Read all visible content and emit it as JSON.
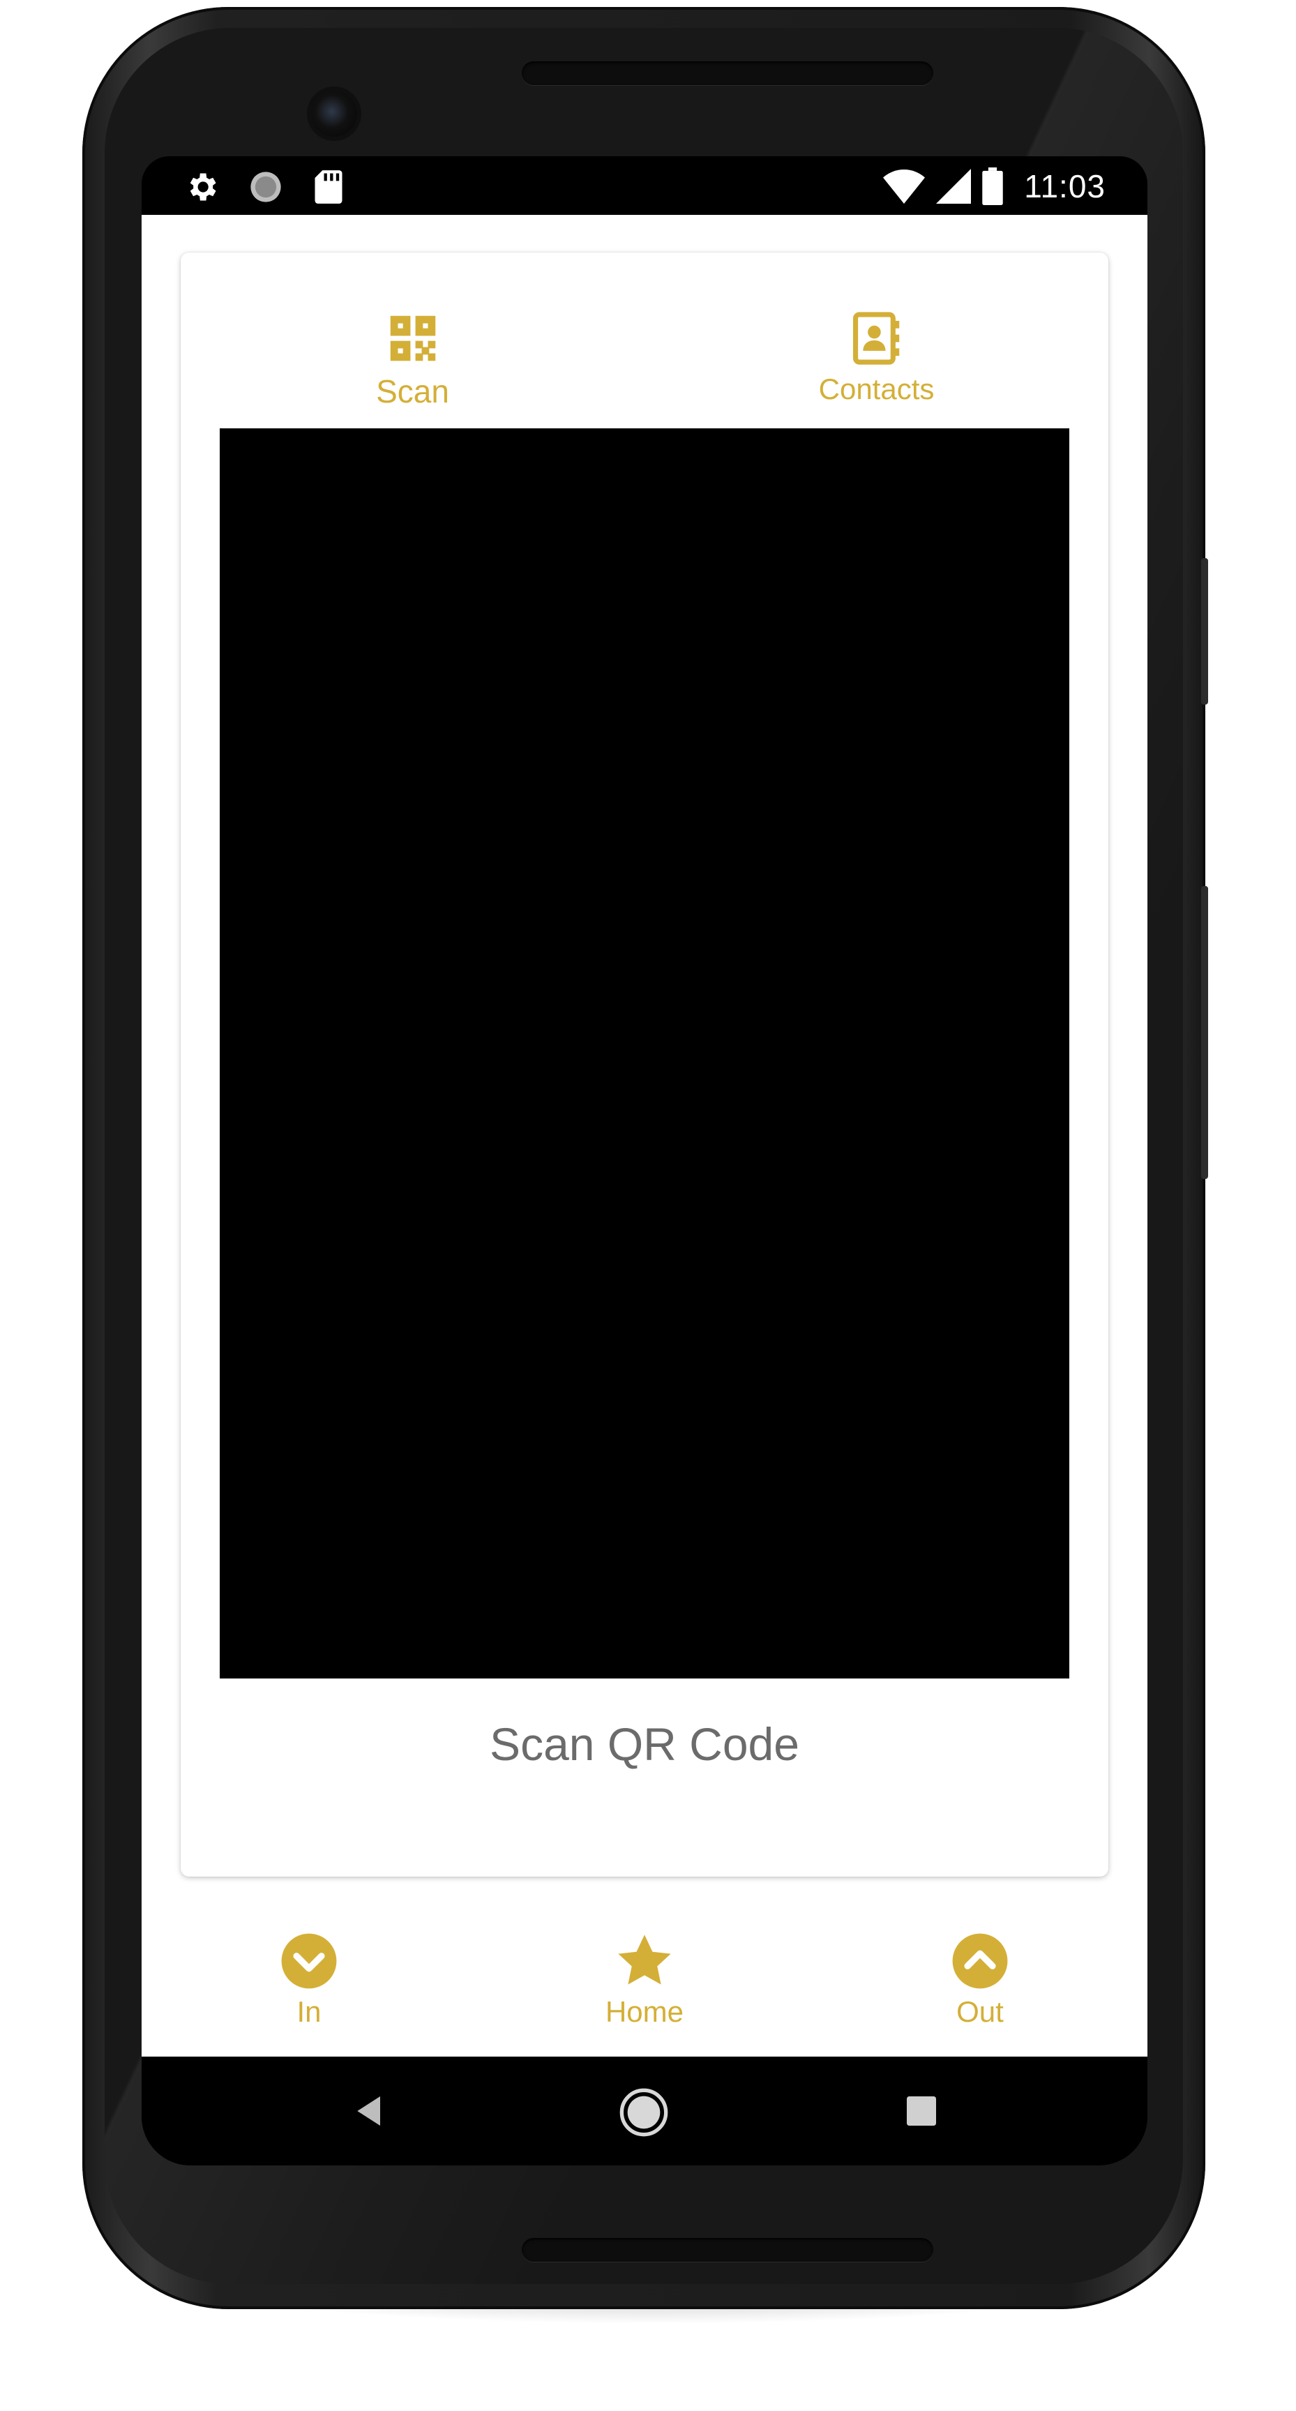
{
  "colors": {
    "accent": "#D4AF37",
    "caption": "#6B6B6B",
    "status_bar": "#000000",
    "preview": "#000000"
  },
  "status_bar": {
    "left_icons": [
      "settings-icon",
      "sync-circle-icon",
      "sd-card-icon"
    ],
    "right_icons": [
      "wifi-icon",
      "signal-icon",
      "battery-icon"
    ],
    "time": "11:03"
  },
  "top_tabs": [
    {
      "label": "Scan",
      "icon": "qr-code-icon",
      "selected": true
    },
    {
      "label": "Contacts",
      "icon": "contact-book-icon",
      "selected": false
    }
  ],
  "scanner": {
    "caption": "Scan QR Code"
  },
  "bottom_nav": [
    {
      "label": "In",
      "icon": "chevron-down-circle-icon"
    },
    {
      "label": "Home",
      "icon": "star-icon"
    },
    {
      "label": "Out",
      "icon": "chevron-up-circle-icon"
    }
  ],
  "system_nav": [
    "back-icon",
    "home-circle-icon",
    "recents-icon"
  ]
}
